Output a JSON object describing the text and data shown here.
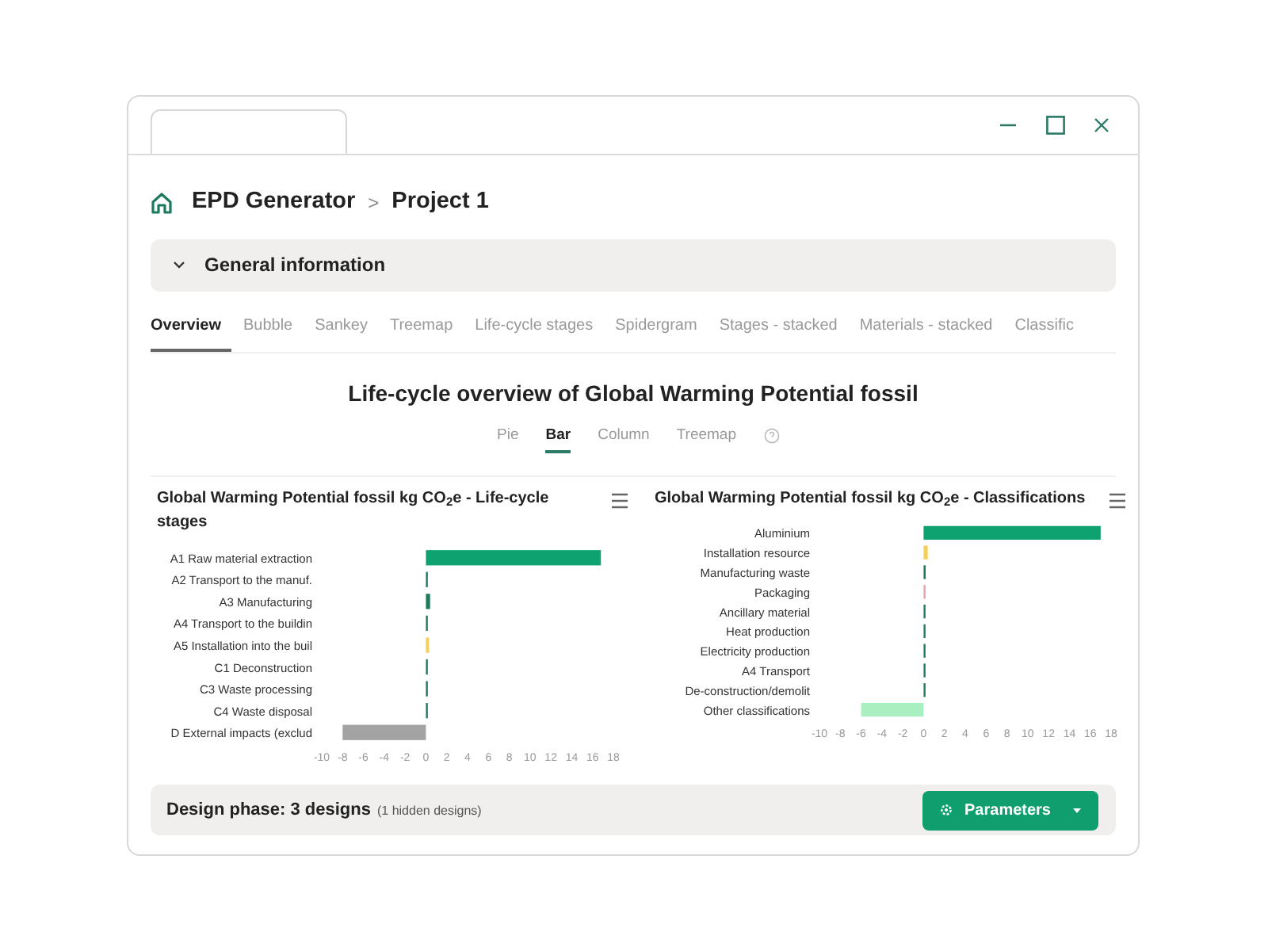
{
  "breadcrumb": {
    "root": "EPD Generator",
    "separator": ">",
    "current": "Project 1"
  },
  "accordion": {
    "title": "General information",
    "expanded": false
  },
  "tabs": [
    {
      "label": "Overview",
      "selected": true
    },
    {
      "label": "Bubble",
      "selected": false
    },
    {
      "label": "Sankey",
      "selected": false
    },
    {
      "label": "Treemap",
      "selected": false
    },
    {
      "label": "Life-cycle stages",
      "selected": false
    },
    {
      "label": "Spidergram",
      "selected": false
    },
    {
      "label": "Stages - stacked",
      "selected": false
    },
    {
      "label": "Materials - stacked",
      "selected": false
    },
    {
      "label": "Classific",
      "selected": false
    }
  ],
  "overview": {
    "title": "Life-cycle overview of Global Warming Potential fossil",
    "chart_types": [
      {
        "label": "Pie",
        "selected": false
      },
      {
        "label": "Bar",
        "selected": true
      },
      {
        "label": "Column",
        "selected": false
      },
      {
        "label": "Treemap",
        "selected": false
      }
    ]
  },
  "charts": [
    {
      "chart_data": {
        "type": "bar",
        "orientation": "horizontal",
        "title": "Global Warming Potential fossil kg CO$_{2}$e - Life-cycle stages",
        "categories": [
          "A1 Raw material extraction",
          "A2 Transport to the manuf.",
          "A3 Manufacturing",
          "A4 Transport to the buildin",
          "A5 Installation into the buil",
          "C1 Deconstruction",
          "C3 Waste processing",
          "C4 Waste disposal",
          "D External impacts (exclud"
        ],
        "series": [
          {
            "colors": [
              "#0ea271",
              "#1f7a5c",
              "#1f7a5c",
              "#1f7a5c",
              "#f5cf5b",
              "#1f7a5c",
              "#1f7a5c",
              "#1f7a5c",
              "#a3a3a3"
            ],
            "values": [
              16.8,
              0.1,
              0.4,
              0.1,
              0.3,
              0.1,
              0.1,
              0.1,
              -8
            ]
          }
        ],
        "xlim": [
          -10,
          18
        ],
        "xticks": [
          -10,
          -8,
          -6,
          -4,
          -2,
          0,
          2,
          4,
          6,
          8,
          10,
          12,
          14,
          16,
          18
        ]
      }
    },
    {
      "chart_data": {
        "type": "bar",
        "orientation": "horizontal",
        "title": "Global Warming Potential fossil kg CO$_{2}$e - Classifications",
        "categories": [
          "Aluminium",
          "Installation resource",
          "Manufacturing waste",
          "Packaging",
          "Ancillary material",
          "Heat production",
          "Electricity production",
          "A4 Transport",
          "De-construction/demolit",
          "Other classifications"
        ],
        "series": [
          {
            "colors": [
              "#0ea271",
              "#f5cf5b",
              "#1f7a5c",
              "#e8a0a8",
              "#1f7a5c",
              "#1f7a5c",
              "#1f7a5c",
              "#1f7a5c",
              "#1f7a5c",
              "#a8f0c0"
            ],
            "values": [
              17,
              0.4,
              0.2,
              0.1,
              0.1,
              0.1,
              0.1,
              0.1,
              0.1,
              -6
            ]
          }
        ],
        "xlim": [
          -10,
          18
        ],
        "xticks": [
          -10,
          -8,
          -6,
          -4,
          -2,
          0,
          2,
          4,
          6,
          8,
          10,
          12,
          14,
          16,
          18
        ]
      }
    }
  ],
  "footer": {
    "title": "Design phase: 3 designs",
    "note": "(1 hidden designs)",
    "button": "Parameters"
  }
}
